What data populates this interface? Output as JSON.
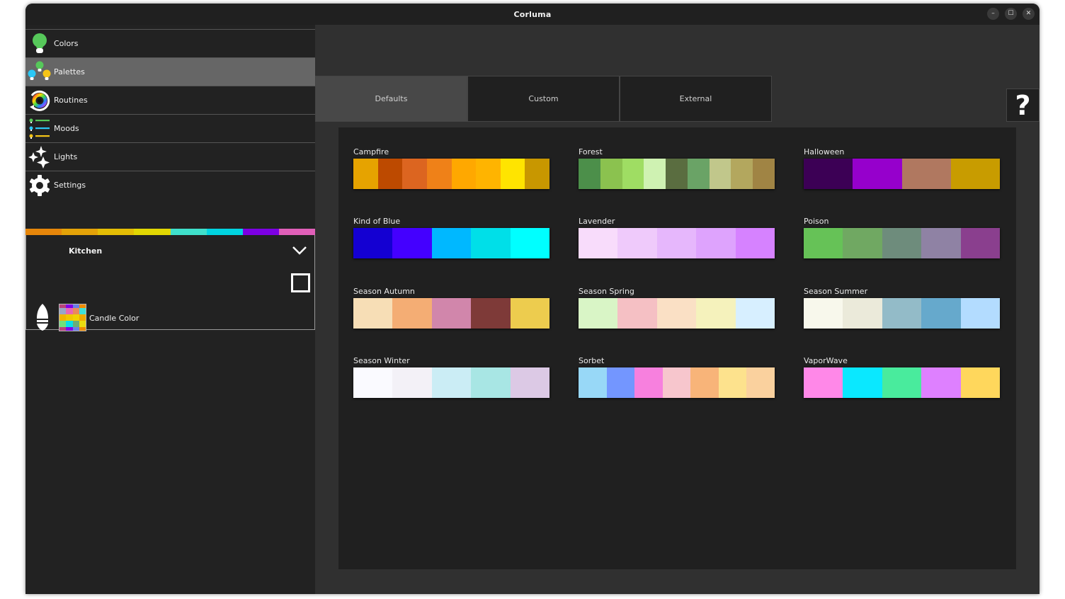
{
  "window": {
    "title": "Corluma",
    "controls": [
      {
        "name": "minimize",
        "glyph": "–"
      },
      {
        "name": "maximize",
        "glyph": "☐"
      },
      {
        "name": "close",
        "glyph": "✕"
      }
    ]
  },
  "sidebar": {
    "items": [
      {
        "label": "Colors",
        "icon": "lightbulb-icon",
        "active": false
      },
      {
        "label": "Palettes",
        "icon": "multi-bulb-icon",
        "active": true
      },
      {
        "label": "Routines",
        "icon": "color-wheel-cycle-icon",
        "active": false
      },
      {
        "label": "Moods",
        "icon": "mood-list-icon",
        "active": false
      },
      {
        "label": "Lights",
        "icon": "sparkles-icon",
        "active": false
      },
      {
        "label": "Settings",
        "icon": "gear-icon",
        "active": false
      }
    ],
    "color_strip": [
      "#e6860a",
      "#e3a208",
      "#e3bd05",
      "#e1d703",
      "#3fe0cb",
      "#00d4e0",
      "#7c00e3",
      "#e05fb8"
    ],
    "room": {
      "name": "Kitchen",
      "light_label": "Candle Color",
      "thumb_colors": [
        "#b8447a",
        "#8100e8",
        "#6a7ee8",
        "#ee8b00",
        "#98a6c8",
        "#e866b3",
        "#ea8a5a",
        "#3fe0d8",
        "#f0b400",
        "#f0c700",
        "#efd300",
        "#f0aa00",
        "#6fe07a",
        "#08dde8",
        "#6aad78",
        "#eadc10",
        "#b8447a",
        "#8100e8",
        "#6a7ee8",
        "#ee8b00"
      ]
    }
  },
  "tabs": [
    {
      "label": "Defaults",
      "active": true
    },
    {
      "label": "Custom",
      "active": false
    },
    {
      "label": "External",
      "active": false
    }
  ],
  "help": {
    "glyph": "?"
  },
  "palettes": [
    {
      "name": "Campfire",
      "colors": [
        "#e6a300",
        "#bd4a00",
        "#dc6520",
        "#ef8118",
        "#ffa800",
        "#ffb400",
        "#ffe400",
        "#c89700"
      ]
    },
    {
      "name": "Forest",
      "colors": [
        "#4c8f4a",
        "#8bc24f",
        "#9fdd63",
        "#cff2b2",
        "#5a6d40",
        "#6aa366",
        "#c1c78b",
        "#b3a75e",
        "#a08444"
      ]
    },
    {
      "name": "Halloween",
      "colors": [
        "#3c0055",
        "#9600cc",
        "#b07860",
        "#c89c00"
      ]
    },
    {
      "name": "Kind of Blue",
      "colors": [
        "#1400d2",
        "#4400ff",
        "#00b8ff",
        "#00dfe8",
        "#00ffff"
      ]
    },
    {
      "name": "Lavender",
      "colors": [
        "#f8dcfb",
        "#efcafb",
        "#e6b7fc",
        "#dea3fd",
        "#d682ff"
      ]
    },
    {
      "name": "Poison",
      "colors": [
        "#66c257",
        "#70a862",
        "#6e8c7c",
        "#8f82a4",
        "#8a3f8e"
      ]
    },
    {
      "name": "Season Autumn",
      "colors": [
        "#f7deb6",
        "#f4ad74",
        "#d186ab",
        "#7e3a38",
        "#edcc4e"
      ]
    },
    {
      "name": "Season Spring",
      "colors": [
        "#d9f5c6",
        "#f5c0c4",
        "#fae0c5",
        "#f5f2bc",
        "#d7efff"
      ]
    },
    {
      "name": "Season Summer",
      "colors": [
        "#f8f8ec",
        "#ebeada",
        "#93bbc8",
        "#66a9cc",
        "#b3dcff"
      ]
    },
    {
      "name": "Season Winter",
      "colors": [
        "#fafaff",
        "#f3f1f7",
        "#cbedf5",
        "#a8e6e4",
        "#dcc9e5"
      ]
    },
    {
      "name": "Sorbet",
      "colors": [
        "#98d8f7",
        "#7396ff",
        "#f780de",
        "#f7c6cd",
        "#f8b479",
        "#fde28d",
        "#fad19e"
      ]
    },
    {
      "name": "VaporWave",
      "colors": [
        "#ff88e8",
        "#0ae8ff",
        "#49eb9d",
        "#de80ff",
        "#ffd75c"
      ]
    }
  ]
}
